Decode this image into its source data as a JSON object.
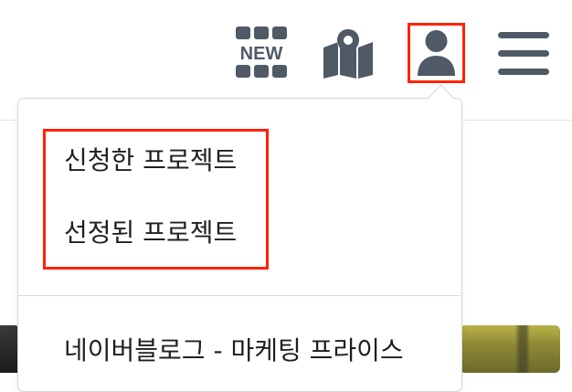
{
  "header": {
    "icons": [
      "new-icon",
      "map-icon",
      "user-icon",
      "menu-icon"
    ],
    "new_icon_text": "NEW",
    "icon_color": "#4f5a66",
    "highlight_color": "#ff2200"
  },
  "dropdown": {
    "items": [
      {
        "label": "신청한 프로젝트"
      },
      {
        "label": "선정된 프로젝트"
      }
    ],
    "recent": [
      {
        "label": "네이버블로그 - 마케팅 프라이스"
      }
    ]
  }
}
